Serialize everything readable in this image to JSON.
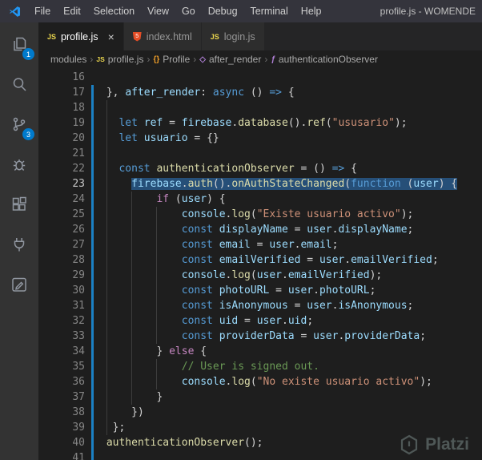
{
  "colors": {
    "accent": "#007acc",
    "selection": "#264f78",
    "modified": "#1b81c4",
    "kw": "#569cd6",
    "ctrl": "#c586c0",
    "var": "#9cdcfe",
    "fn": "#dcdcaa",
    "str": "#ce9178",
    "com": "#6a9955",
    "pun": "#d4d4d4"
  },
  "title_bar": {
    "menus": [
      "File",
      "Edit",
      "Selection",
      "View",
      "Go",
      "Debug",
      "Terminal",
      "Help"
    ],
    "window_title": "profile.js - WOMENDE"
  },
  "activity_bar": {
    "items": [
      {
        "name": "explorer",
        "badge": "1"
      },
      {
        "name": "search"
      },
      {
        "name": "source-control",
        "badge": "3"
      },
      {
        "name": "debug"
      },
      {
        "name": "extensions"
      },
      {
        "name": "plug"
      },
      {
        "name": "edit"
      }
    ]
  },
  "tabs": [
    {
      "label": "profile.js",
      "icon": "js",
      "active": true,
      "close": "×"
    },
    {
      "label": "index.html",
      "icon": "html",
      "active": false
    },
    {
      "label": "login.js",
      "icon": "js",
      "active": false
    }
  ],
  "breadcrumb": {
    "items": [
      {
        "label": "modules"
      },
      {
        "label": "profile.js",
        "icon": "js"
      },
      {
        "label": "Profile",
        "icon": "class"
      },
      {
        "label": "after_render",
        "icon": "method"
      },
      {
        "label": "authenticationObserver",
        "icon": "function"
      }
    ]
  },
  "editor": {
    "lines": [
      {
        "n": 16,
        "i": 0,
        "mod": false,
        "g": [],
        "t": []
      },
      {
        "n": 17,
        "i": 1,
        "mod": true,
        "g": [],
        "t": [
          {
            "c": "pun",
            "s": "}, "
          },
          {
            "c": "var",
            "s": "after_render"
          },
          {
            "c": "pun",
            "s": ": "
          },
          {
            "c": "kw",
            "s": "async"
          },
          {
            "c": "pun",
            "s": " () "
          },
          {
            "c": "kw",
            "s": "=>"
          },
          {
            "c": "pun",
            "s": " {"
          }
        ]
      },
      {
        "n": 18,
        "i": 0,
        "mod": true,
        "g": [
          1
        ],
        "t": []
      },
      {
        "n": 19,
        "i": 3,
        "mod": true,
        "g": [
          1
        ],
        "t": [
          {
            "c": "kw",
            "s": "let"
          },
          {
            "c": "pun",
            "s": " "
          },
          {
            "c": "var",
            "s": "ref"
          },
          {
            "c": "pun",
            "s": " = "
          },
          {
            "c": "var",
            "s": "firebase"
          },
          {
            "c": "pun",
            "s": "."
          },
          {
            "c": "fn",
            "s": "database"
          },
          {
            "c": "pun",
            "s": "()."
          },
          {
            "c": "fn",
            "s": "ref"
          },
          {
            "c": "pun",
            "s": "("
          },
          {
            "c": "str",
            "s": "\"ususario\""
          },
          {
            "c": "pun",
            "s": ");"
          }
        ]
      },
      {
        "n": 20,
        "i": 3,
        "mod": true,
        "g": [
          1
        ],
        "t": [
          {
            "c": "kw",
            "s": "let"
          },
          {
            "c": "pun",
            "s": " "
          },
          {
            "c": "var",
            "s": "usuario"
          },
          {
            "c": "pun",
            "s": " = {}"
          }
        ]
      },
      {
        "n": 21,
        "i": 0,
        "mod": true,
        "g": [
          1
        ],
        "t": []
      },
      {
        "n": 22,
        "i": 3,
        "mod": true,
        "g": [
          1
        ],
        "t": [
          {
            "c": "kw",
            "s": "const"
          },
          {
            "c": "pun",
            "s": " "
          },
          {
            "c": "fn",
            "s": "authenticationObserver"
          },
          {
            "c": "pun",
            "s": " = () "
          },
          {
            "c": "kw",
            "s": "=>"
          },
          {
            "c": "pun",
            "s": " {"
          }
        ]
      },
      {
        "n": 23,
        "i": 5,
        "mod": true,
        "sel": true,
        "g": [
          1
        ],
        "t": [
          {
            "c": "var",
            "s": "firebase"
          },
          {
            "c": "pun",
            "s": "."
          },
          {
            "c": "fn",
            "s": "auth"
          },
          {
            "c": "pun",
            "s": "()."
          },
          {
            "c": "fn",
            "s": "onAuthStateChanged"
          },
          {
            "c": "pun",
            "s": "("
          },
          {
            "c": "kw",
            "s": "function"
          },
          {
            "c": "pun",
            "s": " ("
          },
          {
            "c": "var",
            "s": "user"
          },
          {
            "c": "pun",
            "s": ") {"
          }
        ]
      },
      {
        "n": 24,
        "i": 9,
        "mod": true,
        "g": [
          1,
          5
        ],
        "t": [
          {
            "c": "ctrl",
            "s": "if"
          },
          {
            "c": "pun",
            "s": " ("
          },
          {
            "c": "var",
            "s": "user"
          },
          {
            "c": "pun",
            "s": ") {"
          }
        ]
      },
      {
        "n": 25,
        "i": 13,
        "mod": true,
        "g": [
          1,
          5,
          9
        ],
        "t": [
          {
            "c": "var",
            "s": "console"
          },
          {
            "c": "pun",
            "s": "."
          },
          {
            "c": "fn",
            "s": "log"
          },
          {
            "c": "pun",
            "s": "("
          },
          {
            "c": "str",
            "s": "\"Existe usuario activo\""
          },
          {
            "c": "pun",
            "s": ");"
          }
        ]
      },
      {
        "n": 26,
        "i": 13,
        "mod": true,
        "g": [
          1,
          5,
          9
        ],
        "t": [
          {
            "c": "kw",
            "s": "const"
          },
          {
            "c": "pun",
            "s": " "
          },
          {
            "c": "var",
            "s": "displayName"
          },
          {
            "c": "pun",
            "s": " = "
          },
          {
            "c": "var",
            "s": "user"
          },
          {
            "c": "pun",
            "s": "."
          },
          {
            "c": "var",
            "s": "displayName"
          },
          {
            "c": "pun",
            "s": ";"
          }
        ]
      },
      {
        "n": 27,
        "i": 13,
        "mod": true,
        "g": [
          1,
          5,
          9
        ],
        "t": [
          {
            "c": "kw",
            "s": "const"
          },
          {
            "c": "pun",
            "s": " "
          },
          {
            "c": "var",
            "s": "email"
          },
          {
            "c": "pun",
            "s": " = "
          },
          {
            "c": "var",
            "s": "user"
          },
          {
            "c": "pun",
            "s": "."
          },
          {
            "c": "var",
            "s": "email"
          },
          {
            "c": "pun",
            "s": ";"
          }
        ]
      },
      {
        "n": 28,
        "i": 13,
        "mod": true,
        "g": [
          1,
          5,
          9
        ],
        "t": [
          {
            "c": "kw",
            "s": "const"
          },
          {
            "c": "pun",
            "s": " "
          },
          {
            "c": "var",
            "s": "emailVerified"
          },
          {
            "c": "pun",
            "s": " = "
          },
          {
            "c": "var",
            "s": "user"
          },
          {
            "c": "pun",
            "s": "."
          },
          {
            "c": "var",
            "s": "emailVerified"
          },
          {
            "c": "pun",
            "s": ";"
          }
        ]
      },
      {
        "n": 29,
        "i": 13,
        "mod": true,
        "g": [
          1,
          5,
          9
        ],
        "t": [
          {
            "c": "var",
            "s": "console"
          },
          {
            "c": "pun",
            "s": "."
          },
          {
            "c": "fn",
            "s": "log"
          },
          {
            "c": "pun",
            "s": "("
          },
          {
            "c": "var",
            "s": "user"
          },
          {
            "c": "pun",
            "s": "."
          },
          {
            "c": "var",
            "s": "emailVerified"
          },
          {
            "c": "pun",
            "s": ");"
          }
        ]
      },
      {
        "n": 30,
        "i": 13,
        "mod": true,
        "g": [
          1,
          5,
          9
        ],
        "t": [
          {
            "c": "kw",
            "s": "const"
          },
          {
            "c": "pun",
            "s": " "
          },
          {
            "c": "var",
            "s": "photoURL"
          },
          {
            "c": "pun",
            "s": " = "
          },
          {
            "c": "var",
            "s": "user"
          },
          {
            "c": "pun",
            "s": "."
          },
          {
            "c": "var",
            "s": "photoURL"
          },
          {
            "c": "pun",
            "s": ";"
          }
        ]
      },
      {
        "n": 31,
        "i": 13,
        "mod": true,
        "g": [
          1,
          5,
          9
        ],
        "t": [
          {
            "c": "kw",
            "s": "const"
          },
          {
            "c": "pun",
            "s": " "
          },
          {
            "c": "var",
            "s": "isAnonymous"
          },
          {
            "c": "pun",
            "s": " = "
          },
          {
            "c": "var",
            "s": "user"
          },
          {
            "c": "pun",
            "s": "."
          },
          {
            "c": "var",
            "s": "isAnonymous"
          },
          {
            "c": "pun",
            "s": ";"
          }
        ]
      },
      {
        "n": 32,
        "i": 13,
        "mod": true,
        "g": [
          1,
          5,
          9
        ],
        "t": [
          {
            "c": "kw",
            "s": "const"
          },
          {
            "c": "pun",
            "s": " "
          },
          {
            "c": "var",
            "s": "uid"
          },
          {
            "c": "pun",
            "s": " = "
          },
          {
            "c": "var",
            "s": "user"
          },
          {
            "c": "pun",
            "s": "."
          },
          {
            "c": "var",
            "s": "uid"
          },
          {
            "c": "pun",
            "s": ";"
          }
        ]
      },
      {
        "n": 33,
        "i": 13,
        "mod": true,
        "g": [
          1,
          5,
          9
        ],
        "t": [
          {
            "c": "kw",
            "s": "const"
          },
          {
            "c": "pun",
            "s": " "
          },
          {
            "c": "var",
            "s": "providerData"
          },
          {
            "c": "pun",
            "s": " = "
          },
          {
            "c": "var",
            "s": "user"
          },
          {
            "c": "pun",
            "s": "."
          },
          {
            "c": "var",
            "s": "providerData"
          },
          {
            "c": "pun",
            "s": ";"
          }
        ]
      },
      {
        "n": 34,
        "i": 9,
        "mod": true,
        "g": [
          1,
          5
        ],
        "t": [
          {
            "c": "pun",
            "s": "} "
          },
          {
            "c": "ctrl",
            "s": "else"
          },
          {
            "c": "pun",
            "s": " {"
          }
        ]
      },
      {
        "n": 35,
        "i": 13,
        "mod": true,
        "g": [
          1,
          5,
          9
        ],
        "t": [
          {
            "c": "com",
            "s": "// User is signed out."
          }
        ]
      },
      {
        "n": 36,
        "i": 13,
        "mod": true,
        "g": [
          1,
          5,
          9
        ],
        "t": [
          {
            "c": "var",
            "s": "console"
          },
          {
            "c": "pun",
            "s": "."
          },
          {
            "c": "fn",
            "s": "log"
          },
          {
            "c": "pun",
            "s": "("
          },
          {
            "c": "str",
            "s": "\"No existe usuario activo\""
          },
          {
            "c": "pun",
            "s": ");"
          }
        ]
      },
      {
        "n": 37,
        "i": 9,
        "mod": true,
        "g": [
          1,
          5
        ],
        "t": [
          {
            "c": "pun",
            "s": "}"
          }
        ]
      },
      {
        "n": 38,
        "i": 5,
        "mod": true,
        "g": [
          1
        ],
        "t": [
          {
            "c": "pun",
            "s": "})"
          }
        ]
      },
      {
        "n": 39,
        "i": 2,
        "mod": true,
        "g": [
          1
        ],
        "t": [
          {
            "c": "pun",
            "s": "};"
          }
        ]
      },
      {
        "n": 40,
        "i": 1,
        "mod": true,
        "g": [],
        "t": [
          {
            "c": "fn",
            "s": "authenticationObserver"
          },
          {
            "c": "pun",
            "s": "();"
          }
        ]
      },
      {
        "n": 41,
        "i": 0,
        "mod": true,
        "g": [],
        "t": []
      }
    ]
  },
  "watermark": {
    "label": "Platzi"
  }
}
